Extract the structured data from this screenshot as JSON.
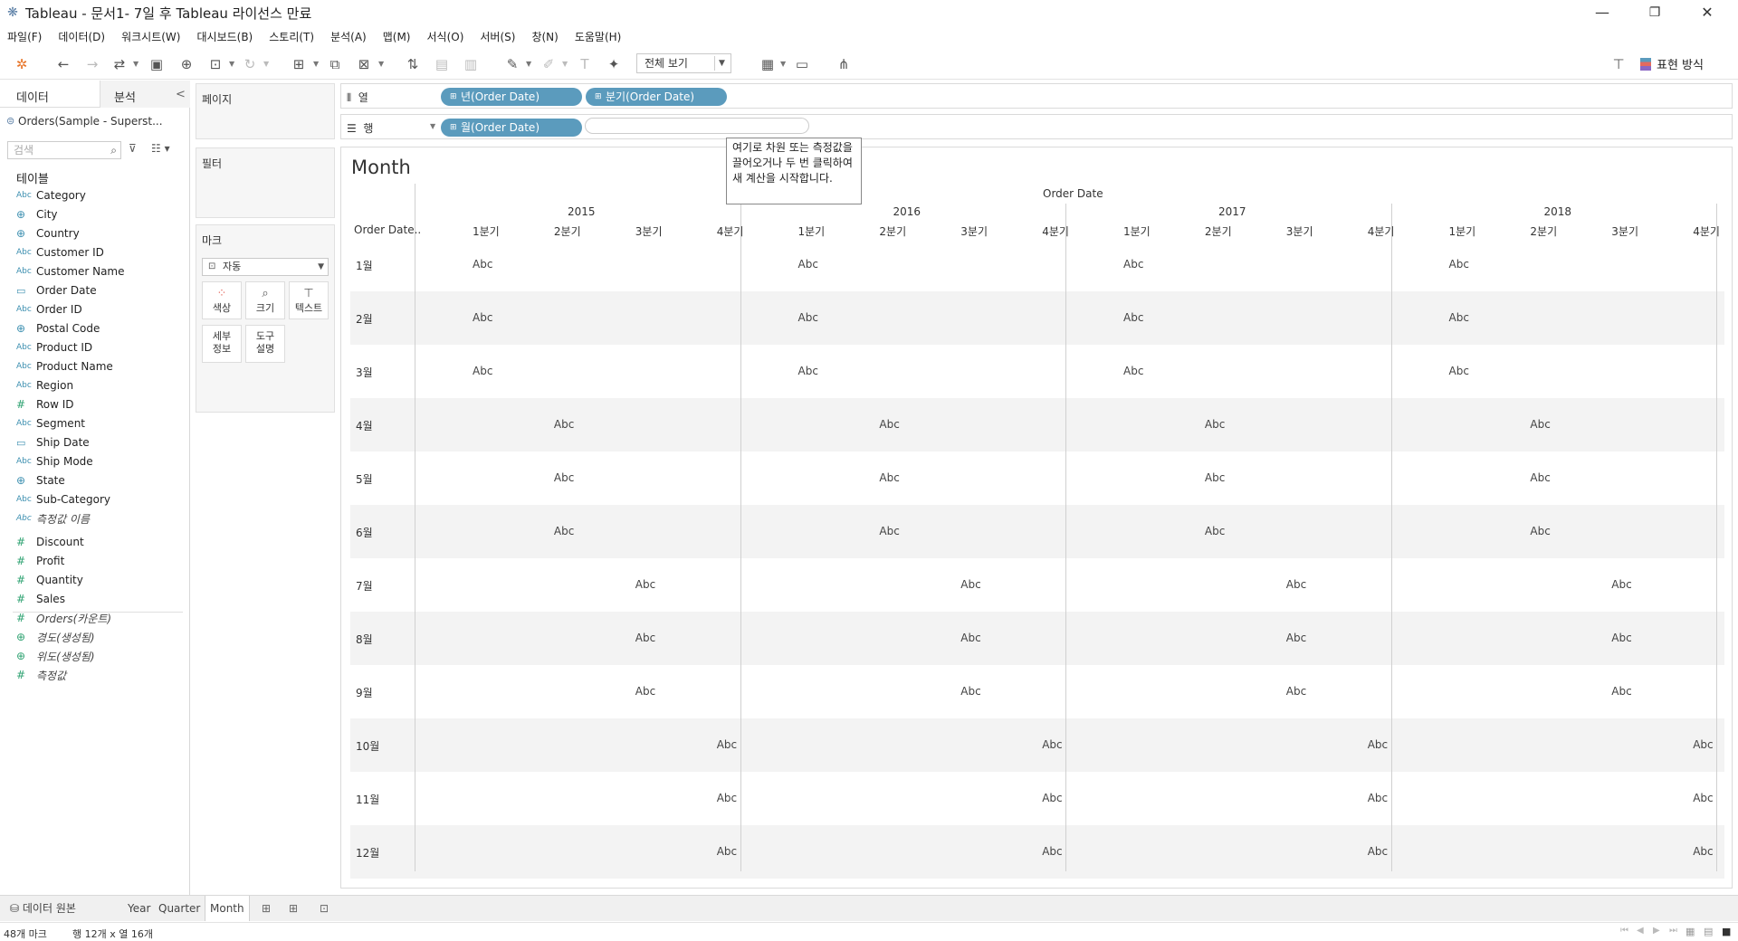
{
  "window": {
    "title": "Tableau - 문서1- 7일 후 Tableau 라이선스 만료",
    "minimize": "—",
    "maximize": "❐",
    "close": "✕"
  },
  "menu": [
    "파일(F)",
    "데이터(D)",
    "워크시트(W)",
    "대시보드(B)",
    "스토리(T)",
    "분석(A)",
    "맵(M)",
    "서식(O)",
    "서버(S)",
    "창(N)",
    "도움말(H)"
  ],
  "toolbar": {
    "view_select": "전체 보기",
    "show_me": "표현 방식"
  },
  "data_pane": {
    "tab_data": "데이터",
    "tab_analysis": "분석",
    "collapse": "<",
    "datasource": "Orders(Sample - Superst...",
    "search_placeholder": "검색",
    "tables_title": "테이블",
    "dimensions": [
      {
        "icon": "Abc",
        "name": "Category"
      },
      {
        "icon": "geo",
        "name": "City"
      },
      {
        "icon": "geo",
        "name": "Country"
      },
      {
        "icon": "Abc",
        "name": "Customer ID"
      },
      {
        "icon": "Abc",
        "name": "Customer Name"
      },
      {
        "icon": "date",
        "name": "Order Date"
      },
      {
        "icon": "Abc",
        "name": "Order ID"
      },
      {
        "icon": "geo",
        "name": "Postal Code"
      },
      {
        "icon": "Abc",
        "name": "Product ID"
      },
      {
        "icon": "Abc",
        "name": "Product Name"
      },
      {
        "icon": "Abc",
        "name": "Region"
      },
      {
        "icon": "#",
        "name": "Row ID"
      },
      {
        "icon": "Abc",
        "name": "Segment"
      },
      {
        "icon": "date",
        "name": "Ship Date"
      },
      {
        "icon": "Abc",
        "name": "Ship Mode"
      },
      {
        "icon": "geo",
        "name": "State"
      },
      {
        "icon": "Abc",
        "name": "Sub-Category"
      },
      {
        "icon": "Abc",
        "name": "측정값 이름",
        "italic": true
      }
    ],
    "measures": [
      {
        "icon": "#",
        "name": "Discount"
      },
      {
        "icon": "#",
        "name": "Profit"
      },
      {
        "icon": "#",
        "name": "Quantity"
      },
      {
        "icon": "#",
        "name": "Sales"
      },
      {
        "icon": "#",
        "name": "Orders(카운트)",
        "italic": true
      },
      {
        "icon": "geo",
        "name": "경도(생성됨)",
        "italic": true
      },
      {
        "icon": "geo",
        "name": "위도(생성됨)",
        "italic": true
      },
      {
        "icon": "#",
        "name": "측정값",
        "italic": true
      }
    ]
  },
  "cards": {
    "pages": "페이지",
    "filters": "필터",
    "marks": "마크",
    "marks_type": "자동",
    "mark_buttons": [
      {
        "label": "색상",
        "icon": "dots-icon"
      },
      {
        "label": "크기",
        "icon": "size-icon"
      },
      {
        "label": "텍스트",
        "icon": "text-icon"
      },
      {
        "label": "세부\n정보",
        "icon": "detail-icon"
      },
      {
        "label": "도구\n설명",
        "icon": "tooltip-icon"
      }
    ]
  },
  "shelves": {
    "columns_label": "열",
    "rows_label": "행",
    "columns_pills": [
      "년(Order Date)",
      "분기(Order Date)"
    ],
    "rows_pills": [
      "월(Order Date)"
    ],
    "drop_tooltip": "여기로 차원 또는 측정값을 끌어오거나 두 번 클릭하여 새 계산을 시작합니다."
  },
  "view": {
    "sheet_title": "Month",
    "column_header_title": "Order Date",
    "row_header_title": "Order Date..",
    "years": [
      "2015",
      "2016",
      "2017",
      "2018"
    ],
    "quarters": [
      "1분기",
      "2분기",
      "3분기",
      "4분기"
    ],
    "months": [
      "1월",
      "2월",
      "3월",
      "4월",
      "5월",
      "6월",
      "7월",
      "8월",
      "9월",
      "10월",
      "11월",
      "12월"
    ],
    "cell_text": "Abc"
  },
  "sheet_tabs": {
    "data_source": "데이터 원본",
    "sheets": [
      "Year",
      "Quarter",
      "Month"
    ],
    "active": "Month"
  },
  "status": {
    "marks": "48개 마크",
    "dims": "행 12개 x 열 16개"
  }
}
